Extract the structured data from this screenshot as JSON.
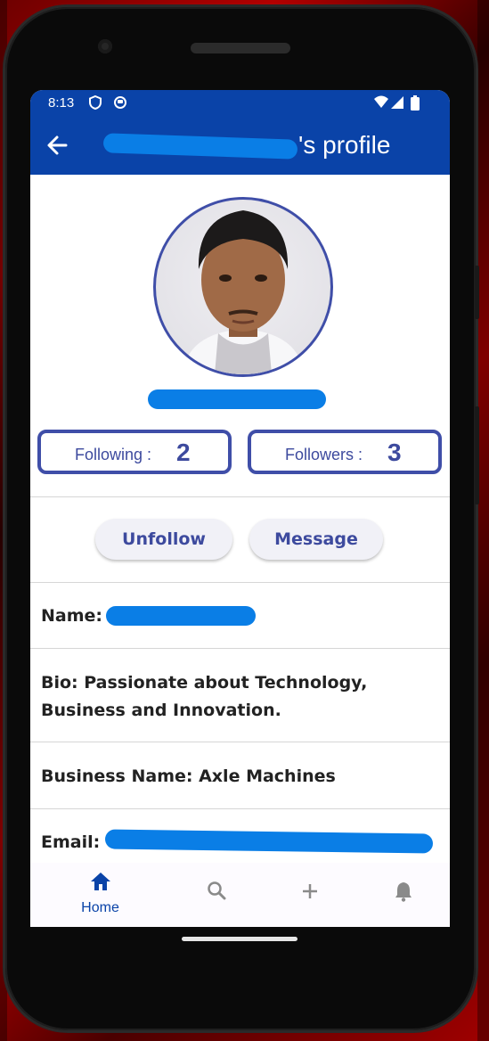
{
  "status_bar": {
    "time": "8:13",
    "icons": [
      "shield-icon",
      "app-notification-icon",
      "wifi-icon",
      "cellular-signal-icon",
      "battery-icon"
    ]
  },
  "app_bar": {
    "title_suffix": "'s profile",
    "back_icon": "back-arrow-icon",
    "color": "#0a43a8"
  },
  "profile": {
    "following_label": "Following :",
    "following_count": "2",
    "followers_label": "Followers :",
    "followers_count": "3",
    "accent": "#3f4ea8"
  },
  "actions": {
    "unfollow_label": "Unfollow",
    "message_label": "Message"
  },
  "details": {
    "name_label": "Name:",
    "bio_line1": "Bio: Passionate about Technology,",
    "bio_line2": "Business and Innovation.",
    "business": "Business Name: Axle Machines",
    "email_label": "Email:"
  },
  "bottom_nav": {
    "home_label": "Home",
    "icons": [
      "home-icon",
      "search-icon",
      "add-icon",
      "notifications-icon"
    ]
  }
}
